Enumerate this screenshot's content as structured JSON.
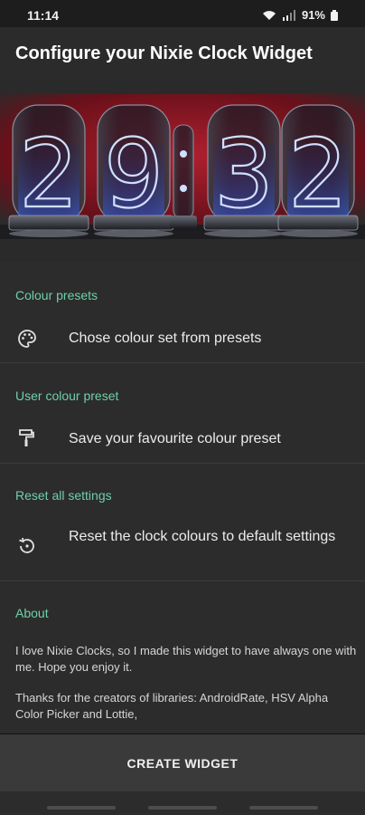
{
  "status_bar": {
    "time": "11:14",
    "battery": "91%",
    "icons": [
      "wifi-icon",
      "signal-icon",
      "battery-icon"
    ]
  },
  "app_bar": {
    "title": "Configure your Nixie Clock Widget"
  },
  "preview": {
    "digits": [
      "2",
      "9",
      "3",
      "2"
    ],
    "colors": {
      "background": "#7d1620",
      "glow": "#3a5ed8",
      "filament": "#cfe0ff"
    }
  },
  "settings": {
    "colour_presets": {
      "category": "Colour presets",
      "title": "Chose colour set from presets",
      "icon": "palette-icon"
    },
    "user_preset": {
      "category": "User colour preset",
      "title": "Save your favourite colour preset",
      "icon": "paint-roller-icon"
    },
    "reset": {
      "category": "Reset all settings",
      "title": "Reset the clock colours to default settings",
      "icon": "restore-icon"
    },
    "about": {
      "category": "About",
      "text1": "I love Nixie Clocks, so I made this widget to have always one with me. Hope you enjoy it.",
      "text2": "Thanks for the creators of libraries: AndroidRate, HSV Alpha Color Picker and Lottie,"
    }
  },
  "create_button": {
    "label": "CREATE WIDGET"
  },
  "theme": {
    "accent": "#6ecfa9",
    "surface": "#2c2c2c",
    "app_bar": "#2b2b2b"
  }
}
